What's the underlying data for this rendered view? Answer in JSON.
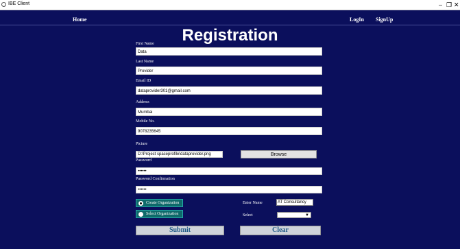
{
  "window": {
    "title": "IBE Client",
    "controls": [
      "–",
      "❐",
      "✕"
    ]
  },
  "nav": {
    "home": "Home",
    "login": "LogIn",
    "signup": "SignUp"
  },
  "page": {
    "heading": "Registration"
  },
  "form": {
    "first_name": {
      "label": "First Name",
      "value": "Data"
    },
    "last_name": {
      "label": "Last Name",
      "value": "Provider"
    },
    "email": {
      "label": "Email ID",
      "value": "dataprovider301@gmail.com"
    },
    "address": {
      "label": "Address",
      "value": "Mumbai"
    },
    "mobile": {
      "label": "Mobile No.",
      "value": "9078235645"
    },
    "picture": {
      "label": "Picture",
      "value": "D:\\Project spaceprofile\\dataprovider.png",
      "browse": "Browse"
    },
    "password": {
      "label": "Password",
      "value": "••••••"
    },
    "password_confirm": {
      "label": "Password Confirmation",
      "value": "••••••"
    }
  },
  "organization": {
    "create_label": "Create Organization",
    "select_label": "Select Organization",
    "enter_name_label": "Enter Name",
    "enter_name_value": "AT Consultancy",
    "select_text": "Select",
    "select_value": "",
    "selected": "create"
  },
  "actions": {
    "submit": "Submit",
    "clear": "Clear"
  },
  "colors": {
    "background": "#0b0f5c",
    "radio_bg": "#0f6a6a",
    "button_text": "#1f5a86"
  }
}
